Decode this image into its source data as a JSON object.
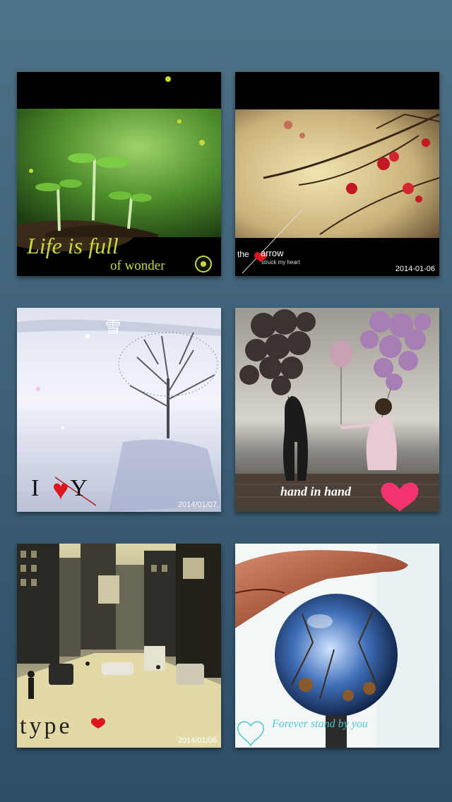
{
  "cards": [
    {
      "id": "life",
      "caption_line1": "Life is full",
      "caption_line2": "of wonder",
      "date": ""
    },
    {
      "id": "arrow",
      "caption_the": "the",
      "caption_arrow": "arrow",
      "caption_sub": "struck my heart",
      "date": "2014-01-06"
    },
    {
      "id": "snow",
      "caption_left": "I",
      "caption_heart": "♥",
      "caption_right": "Y",
      "date": "2014/01/07"
    },
    {
      "id": "balloons",
      "caption": "hand in hand",
      "date": ""
    },
    {
      "id": "city",
      "caption": "type",
      "date": "2014/01/06"
    },
    {
      "id": "globe",
      "caption": "Forever stand by you",
      "date": ""
    }
  ],
  "colors": {
    "background_top": "#4d7186",
    "background_bottom": "#2e4d66",
    "accent_green": "#c7d93a",
    "accent_red": "#e0141c",
    "accent_teal": "#4cc7c9"
  }
}
